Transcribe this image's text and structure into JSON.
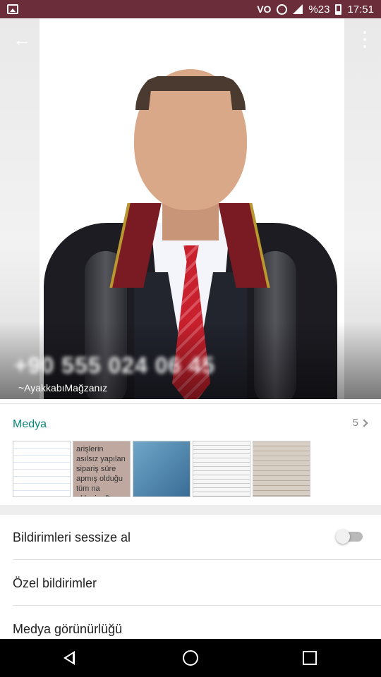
{
  "status_bar": {
    "battery_text": "%23",
    "time": "17:51",
    "vibrate_label": "VO"
  },
  "profile": {
    "phone_number": "+90 555 024 06 45",
    "push_name": "~AyakkabıMağzanız"
  },
  "media": {
    "title": "Medya",
    "count": "5",
    "thumb_2_text": "arişlerin asılsız yapılan sipariş süre apmış olduğu tüm na eklenip. Bu sebe lektronik Ticaret\" ariyet Başsavcılığı Bulunulacaktır."
  },
  "settings": {
    "mute_label": "Bildirimleri sessize al",
    "mute_enabled": false,
    "custom_notifications_label": "Özel bildirimler",
    "media_visibility_label": "Medya görünürlüğü"
  },
  "colors": {
    "status_bar": "#6b2d3a",
    "accent": "#0c8577"
  }
}
